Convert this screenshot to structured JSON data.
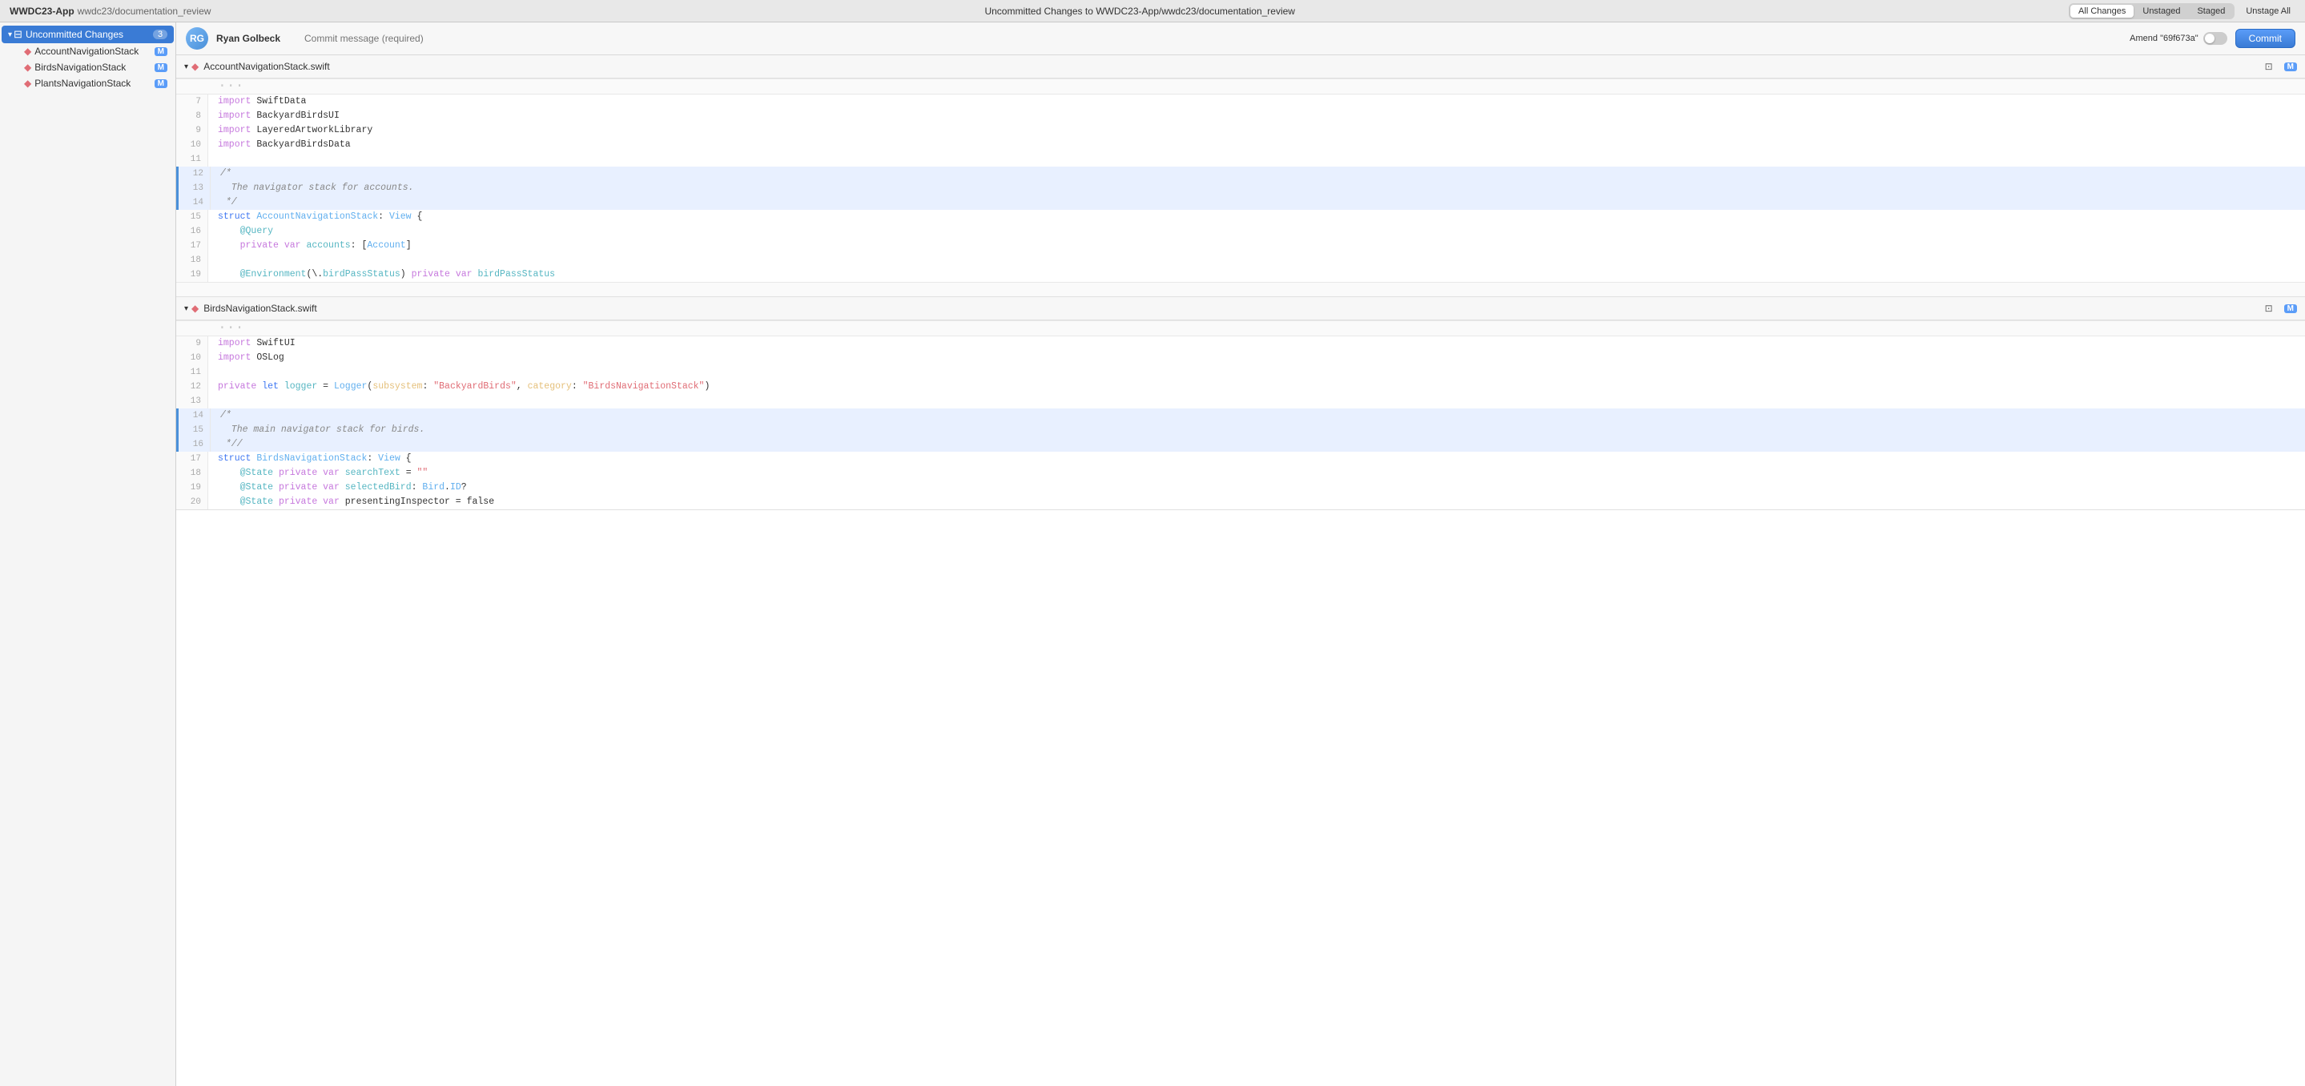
{
  "titleBar": {
    "appName": "WWDC23-App",
    "repoPath": "wwdc23/documentation_review",
    "centerText": "Uncommitted Changes to WWDC23-App/wwdc23/documentation_review",
    "tabs": [
      {
        "id": "all",
        "label": "All Changes",
        "active": true
      },
      {
        "id": "unstaged",
        "label": "Unstaged",
        "active": false
      },
      {
        "id": "staged",
        "label": "Staged",
        "active": false
      }
    ],
    "unstageAllLabel": "Unstage All"
  },
  "sidebar": {
    "uncommittedLabel": "Uncommitted Changes",
    "uncommittedCount": "3",
    "files": [
      {
        "name": "AccountNavigationStack",
        "badge": "M"
      },
      {
        "name": "BirdsNavigationStack",
        "badge": "M"
      },
      {
        "name": "PlantsNavigationStack",
        "badge": "M"
      }
    ]
  },
  "commitBar": {
    "avatarInitials": "RG",
    "authorName": "Ryan Golbeck",
    "messagePlaceholder": "Commit message (required)",
    "amendLabel": "Amend \"69f673a\"",
    "commitLabel": "Commit"
  },
  "files": [
    {
      "id": "file1",
      "name": "AccountNavigationStack.swift",
      "badge": "M",
      "lines": [
        {
          "num": "7",
          "type": "normal",
          "tokens": [
            {
              "t": "kw",
              "v": "import"
            },
            {
              "t": "plain",
              "v": " SwiftData"
            }
          ]
        },
        {
          "num": "8",
          "type": "normal",
          "tokens": [
            {
              "t": "kw",
              "v": "import"
            },
            {
              "t": "plain",
              "v": " BackyardBirdsUI"
            }
          ]
        },
        {
          "num": "9",
          "type": "normal",
          "tokens": [
            {
              "t": "kw",
              "v": "import"
            },
            {
              "t": "plain",
              "v": " LayeredArtworkLibrary"
            }
          ]
        },
        {
          "num": "10",
          "type": "normal",
          "tokens": [
            {
              "t": "kw",
              "v": "import"
            },
            {
              "t": "plain",
              "v": " BackyardBirdsData"
            }
          ]
        },
        {
          "num": "11",
          "type": "normal",
          "tokens": [
            {
              "t": "plain",
              "v": ""
            }
          ]
        },
        {
          "num": "12",
          "type": "highlight",
          "tokens": [
            {
              "t": "comment",
              "v": "/*"
            }
          ]
        },
        {
          "num": "13",
          "type": "highlight",
          "tokens": [
            {
              "t": "comment",
              "v": "  The navigator stack for accounts."
            }
          ]
        },
        {
          "num": "14",
          "type": "highlight",
          "tokens": [
            {
              "t": "comment",
              "v": " */"
            }
          ]
        },
        {
          "num": "15",
          "type": "normal",
          "tokens": [
            {
              "t": "kw-blue",
              "v": "struct"
            },
            {
              "t": "plain",
              "v": " "
            },
            {
              "t": "type",
              "v": "AccountNavigationStack"
            },
            {
              "t": "plain",
              "v": ": "
            },
            {
              "t": "type",
              "v": "View"
            },
            {
              "t": "plain",
              "v": " {"
            }
          ]
        },
        {
          "num": "16",
          "type": "normal",
          "tokens": [
            {
              "t": "plain",
              "v": "    "
            },
            {
              "t": "prop",
              "v": "@Query"
            }
          ]
        },
        {
          "num": "17",
          "type": "normal",
          "tokens": [
            {
              "t": "plain",
              "v": "    "
            },
            {
              "t": "kw",
              "v": "private"
            },
            {
              "t": "plain",
              "v": " "
            },
            {
              "t": "kw",
              "v": "var"
            },
            {
              "t": "plain",
              "v": " "
            },
            {
              "t": "prop",
              "v": "accounts"
            },
            {
              "t": "plain",
              "v": ": ["
            },
            {
              "t": "type",
              "v": "Account"
            },
            {
              "t": "plain",
              "v": "]"
            }
          ]
        },
        {
          "num": "18",
          "type": "normal",
          "tokens": [
            {
              "t": "plain",
              "v": ""
            }
          ]
        },
        {
          "num": "19",
          "type": "normal",
          "tokens": [
            {
              "t": "plain",
              "v": "    "
            },
            {
              "t": "prop",
              "v": "@Environment"
            },
            {
              "t": "plain",
              "v": "(\\."
            },
            {
              "t": "prop",
              "v": "birdPassStatus"
            },
            {
              "t": "plain",
              "v": ") "
            },
            {
              "t": "kw",
              "v": "private"
            },
            {
              "t": "plain",
              "v": " "
            },
            {
              "t": "kw",
              "v": "var"
            },
            {
              "t": "plain",
              "v": " "
            },
            {
              "t": "prop",
              "v": "birdPassStatus"
            }
          ]
        }
      ]
    },
    {
      "id": "file2",
      "name": "BirdsNavigationStack.swift",
      "badge": "M",
      "lines": [
        {
          "num": "9",
          "type": "normal",
          "tokens": [
            {
              "t": "kw",
              "v": "import"
            },
            {
              "t": "plain",
              "v": " SwiftUI"
            }
          ]
        },
        {
          "num": "10",
          "type": "normal",
          "tokens": [
            {
              "t": "kw",
              "v": "import"
            },
            {
              "t": "plain",
              "v": " OSLog"
            }
          ]
        },
        {
          "num": "11",
          "type": "normal",
          "tokens": [
            {
              "t": "plain",
              "v": ""
            }
          ]
        },
        {
          "num": "12",
          "type": "normal",
          "tokens": [
            {
              "t": "kw",
              "v": "private"
            },
            {
              "t": "plain",
              "v": " "
            },
            {
              "t": "kw-blue",
              "v": "let"
            },
            {
              "t": "plain",
              "v": " "
            },
            {
              "t": "prop",
              "v": "logger"
            },
            {
              "t": "plain",
              "v": " = "
            },
            {
              "t": "type",
              "v": "Logger"
            },
            {
              "t": "plain",
              "v": "("
            },
            {
              "t": "param",
              "v": "subsystem"
            },
            {
              "t": "plain",
              "v": ": "
            },
            {
              "t": "str",
              "v": "\"BackyardBirds\""
            },
            {
              "t": "plain",
              "v": ", "
            },
            {
              "t": "param",
              "v": "category"
            },
            {
              "t": "plain",
              "v": ": "
            },
            {
              "t": "str",
              "v": "\"BirdsNavigationStack\""
            },
            {
              "t": "plain",
              "v": ")"
            }
          ]
        },
        {
          "num": "13",
          "type": "normal",
          "tokens": [
            {
              "t": "plain",
              "v": ""
            }
          ]
        },
        {
          "num": "14",
          "type": "highlight",
          "tokens": [
            {
              "t": "comment",
              "v": "/*"
            }
          ]
        },
        {
          "num": "15",
          "type": "highlight",
          "tokens": [
            {
              "t": "comment",
              "v": "  The main navigator stack for birds."
            }
          ]
        },
        {
          "num": "16",
          "type": "highlight",
          "tokens": [
            {
              "t": "comment",
              "v": " *//"
            }
          ]
        },
        {
          "num": "17",
          "type": "normal",
          "tokens": [
            {
              "t": "kw-blue",
              "v": "struct"
            },
            {
              "t": "plain",
              "v": " "
            },
            {
              "t": "type",
              "v": "BirdsNavigationStack"
            },
            {
              "t": "plain",
              "v": ": "
            },
            {
              "t": "type",
              "v": "View"
            },
            {
              "t": "plain",
              "v": " {"
            }
          ]
        },
        {
          "num": "18",
          "type": "normal",
          "tokens": [
            {
              "t": "plain",
              "v": "    "
            },
            {
              "t": "prop",
              "v": "@State"
            },
            {
              "t": "plain",
              "v": " "
            },
            {
              "t": "kw",
              "v": "private"
            },
            {
              "t": "plain",
              "v": " "
            },
            {
              "t": "kw",
              "v": "var"
            },
            {
              "t": "plain",
              "v": " "
            },
            {
              "t": "prop",
              "v": "searchText"
            },
            {
              "t": "plain",
              "v": " = "
            },
            {
              "t": "str",
              "v": "\"\""
            }
          ]
        },
        {
          "num": "19",
          "type": "normal",
          "tokens": [
            {
              "t": "plain",
              "v": "    "
            },
            {
              "t": "prop",
              "v": "@State"
            },
            {
              "t": "plain",
              "v": " "
            },
            {
              "t": "kw",
              "v": "private"
            },
            {
              "t": "plain",
              "v": " "
            },
            {
              "t": "kw",
              "v": "var"
            },
            {
              "t": "plain",
              "v": " "
            },
            {
              "t": "prop",
              "v": "selectedBird"
            },
            {
              "t": "plain",
              "v": ": "
            },
            {
              "t": "type",
              "v": "Bird"
            },
            {
              "t": "plain",
              "v": "."
            },
            {
              "t": "type",
              "v": "ID"
            },
            {
              "t": "plain",
              "v": "?"
            }
          ]
        },
        {
          "num": "20",
          "type": "normal",
          "tokens": [
            {
              "t": "plain",
              "v": "    "
            },
            {
              "t": "prop",
              "v": "@State"
            },
            {
              "t": "plain",
              "v": " "
            },
            {
              "t": "kw",
              "v": "private"
            },
            {
              "t": "plain",
              "v": " "
            },
            {
              "t": "kw",
              "v": "var"
            },
            {
              "t": "plain",
              "v": " presentingInspector = false"
            }
          ]
        }
      ]
    }
  ],
  "icons": {
    "chevronDown": "▾",
    "fileSwift": "◆",
    "collapseIcon": "⊡",
    "expandIcon": "⊞"
  }
}
